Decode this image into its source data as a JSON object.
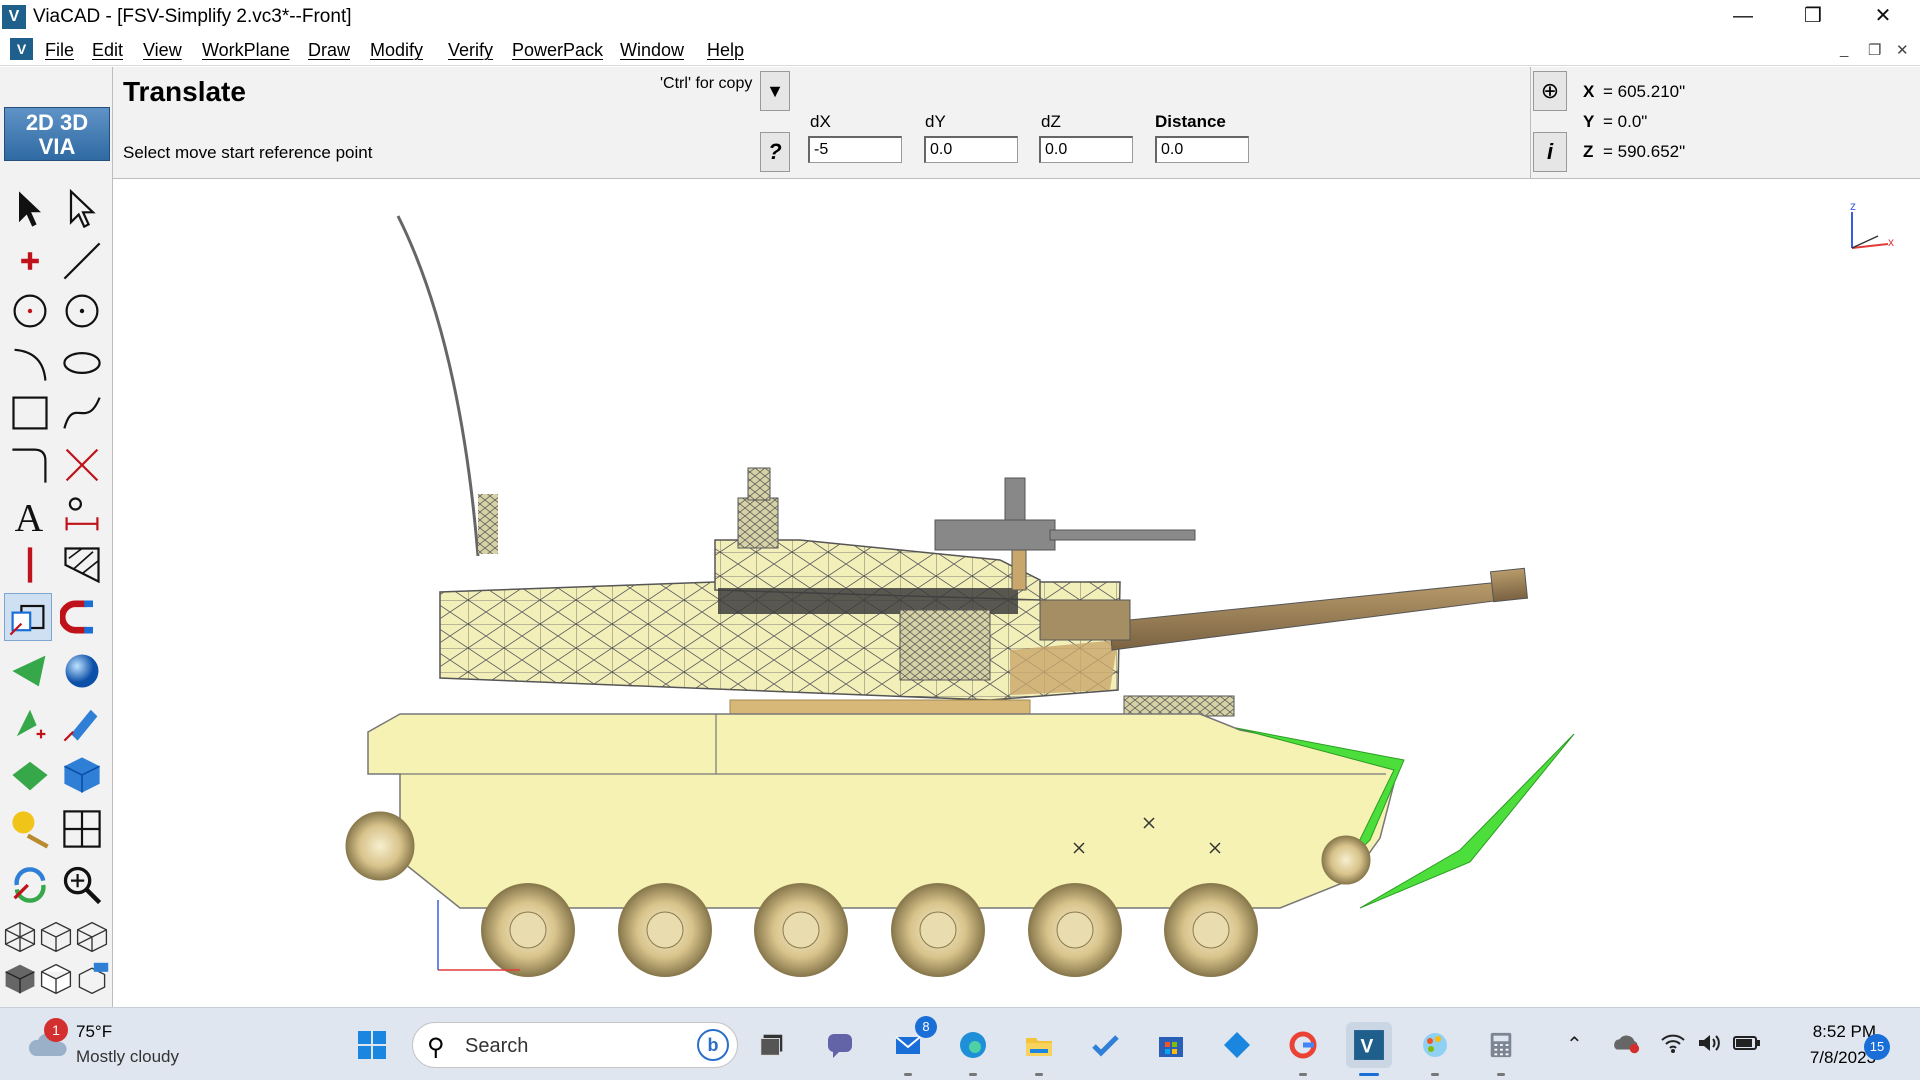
{
  "window": {
    "title": "ViaCAD - [FSV-Simplify 2.vc3*--Front]",
    "minimize": "—",
    "restore": "❒",
    "close": "✕",
    "logo": "V"
  },
  "menu": {
    "items": [
      "File",
      "Edit",
      "View",
      "WorkPlane",
      "Draw",
      "Modify",
      "Verify",
      "PowerPack",
      "Window",
      "Help"
    ],
    "doc_min": "_",
    "doc_restore": "❐",
    "doc_close": "✕"
  },
  "command": {
    "title": "Translate",
    "prompt": "Select move start reference point",
    "ctrl_hint": "'Ctrl' for copy",
    "dropdown": "▼",
    "help": "?",
    "fields": [
      {
        "label": "dX",
        "value": "-5"
      },
      {
        "label": "dY",
        "value": "0.0"
      },
      {
        "label": "dZ",
        "value": "0.0"
      },
      {
        "label": "Distance",
        "value": "0.0"
      }
    ],
    "snap": "⊕",
    "info": "i"
  },
  "coords": {
    "x_label": "X",
    "x_value": "= 605.210\"",
    "y_label": "Y",
    "y_value": "= 0.0\"",
    "z_label": "Z",
    "z_value": "= 590.652\""
  },
  "palette": {
    "logo": "2D 3D VIA"
  },
  "canvas": {
    "axis_z": "z",
    "axis_x": "x"
  },
  "taskbar": {
    "weather_badge": "1",
    "weather_temp": "75°F",
    "weather_cond": "Mostly cloudy",
    "search_label": "Search",
    "mail_badge": "8",
    "time": "8:52 PM",
    "date": "7/8/2023",
    "notif_count": "15"
  },
  "colors": {
    "hull": "#f6f2b3",
    "wire": "#4a4a4a",
    "accent_green": "#4cdf3c",
    "wheel": "#d9c68a",
    "taskbar": "#dfe6f0",
    "panel": "#f2f2f2"
  }
}
